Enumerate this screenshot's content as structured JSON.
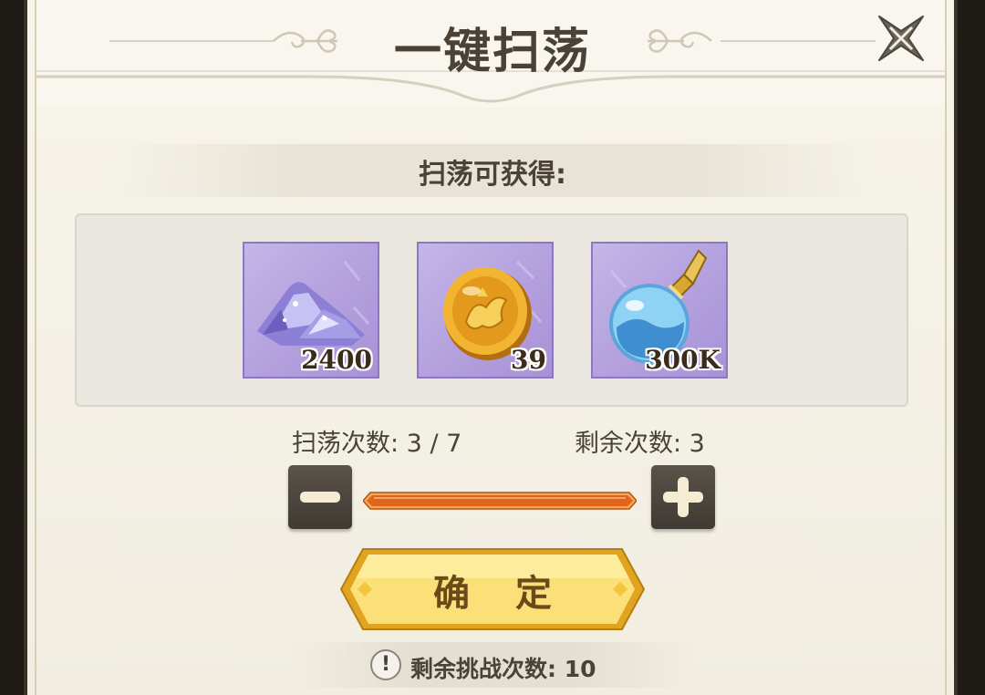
{
  "dialog": {
    "title": "一键扫荡",
    "subtitle": "扫荡可获得:",
    "close_icon": "close-x-icon"
  },
  "rewards": [
    {
      "icon": "crystal-pile-icon",
      "quantity": "2400"
    },
    {
      "icon": "gold-coin-icon",
      "quantity": "39"
    },
    {
      "icon": "potion-flask-icon",
      "quantity": "300K"
    }
  ],
  "sweep": {
    "count_label": "扫荡次数: 3 / 7",
    "remaining_label": "剩余次数: 3",
    "current": 3,
    "max": 7,
    "minus_icon": "minus-icon",
    "plus_icon": "plus-icon"
  },
  "confirm": {
    "label": "确 定"
  },
  "footer": {
    "warning_icon": "exclamation-icon",
    "text": "剩余挑战次数: 10"
  },
  "colors": {
    "panel_bg": "#f4f1e7",
    "item_bg": "#b8a6e0",
    "slider_fill": "#e06a1c",
    "button_gold": "#f7d24a",
    "stepper_dark": "#4a443c",
    "text_dark": "#4a4237"
  }
}
